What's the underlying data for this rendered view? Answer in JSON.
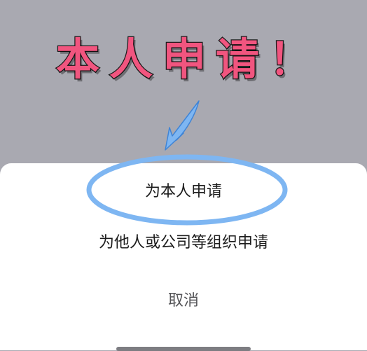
{
  "annotation": {
    "title": "本人申请！",
    "title_color": "#f1557f",
    "highlight_color": "#7eb6f2"
  },
  "action_sheet": {
    "options": [
      {
        "label": "为本人申请"
      },
      {
        "label": "为他人或公司等组织申请"
      }
    ],
    "cancel_label": "取消"
  }
}
